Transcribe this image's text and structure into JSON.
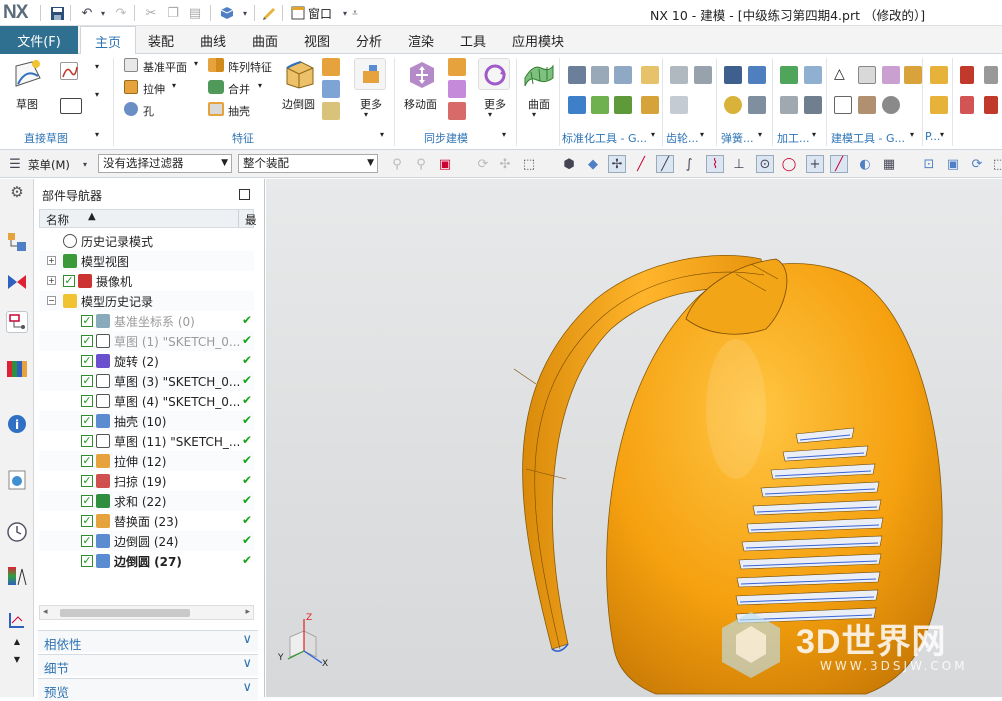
{
  "app": {
    "logo": "NX",
    "window_title": "NX 10 - 建模 - [中级练习第四期4.prt （修改的）]",
    "window_menu": "窗口"
  },
  "menu": {
    "file": "文件(F)",
    "tabs": [
      "主页",
      "装配",
      "曲线",
      "曲面",
      "视图",
      "分析",
      "渲染",
      "工具",
      "应用模块"
    ]
  },
  "ribbon": {
    "sketch": "草图",
    "datum_plane": "基准平面",
    "extrude": "拉伸",
    "hole": "孔",
    "pattern_feature": "阵列特征",
    "unite": "合并",
    "shell": "抽壳",
    "edge_blend": "边倒圆",
    "more": "更多",
    "move_face": "移动面",
    "more2": "更多",
    "surface": "曲面",
    "groups": {
      "direct_sketch": "直接草图",
      "feature": "特征",
      "sync_modeling": "同步建模",
      "standard_tools": "标准化工具 - G...",
      "gear": "齿轮...",
      "spring": "弹簧...",
      "machining": "加工...",
      "modeling_tools": "建模工具 - G...",
      "p": "P..."
    }
  },
  "toolbar2": {
    "menu": "菜单(M)",
    "filter": "没有选择过滤器",
    "scope": "整个装配"
  },
  "navigator": {
    "title": "部件导航器",
    "col_name": "名称",
    "col_latest": "最",
    "rows": [
      {
        "label": "历史记录模式",
        "indent": 0,
        "icon": "clock",
        "check": false,
        "ok": false,
        "style": ""
      },
      {
        "label": "模型视图",
        "indent": 0,
        "icon": "view",
        "check": false,
        "ok": false,
        "style": "",
        "exp": "+"
      },
      {
        "label": "摄像机",
        "indent": 0,
        "icon": "camera",
        "check": true,
        "ok": false,
        "style": "",
        "exp": "+"
      },
      {
        "label": "模型历史记录",
        "indent": 0,
        "icon": "folder",
        "check": false,
        "ok": false,
        "style": "",
        "exp": "-"
      },
      {
        "label": "基准坐标系 (0)",
        "indent": 1,
        "icon": "csys",
        "check": true,
        "ok": true,
        "style": "gray"
      },
      {
        "label": "草图 (1) \"SKETCH_0...",
        "indent": 1,
        "icon": "sketch",
        "check": true,
        "ok": true,
        "style": "gray"
      },
      {
        "label": "旋转 (2)",
        "indent": 1,
        "icon": "revolve",
        "check": true,
        "ok": true,
        "style": ""
      },
      {
        "label": "草图 (3) \"SKETCH_0...",
        "indent": 1,
        "icon": "sketch",
        "check": true,
        "ok": true,
        "style": ""
      },
      {
        "label": "草图 (4) \"SKETCH_0...",
        "indent": 1,
        "icon": "sketch",
        "check": true,
        "ok": true,
        "style": ""
      },
      {
        "label": "抽壳 (10)",
        "indent": 1,
        "icon": "shell",
        "check": true,
        "ok": true,
        "style": ""
      },
      {
        "label": "草图 (11) \"SKETCH_...",
        "indent": 1,
        "icon": "sketch",
        "check": true,
        "ok": true,
        "style": ""
      },
      {
        "label": "拉伸 (12)",
        "indent": 1,
        "icon": "extrude",
        "check": true,
        "ok": true,
        "style": ""
      },
      {
        "label": "扫掠 (19)",
        "indent": 1,
        "icon": "sweep",
        "check": true,
        "ok": true,
        "style": ""
      },
      {
        "label": "求和 (22)",
        "indent": 1,
        "icon": "unite",
        "check": true,
        "ok": true,
        "style": ""
      },
      {
        "label": "替换面 (23)",
        "indent": 1,
        "icon": "replace",
        "check": true,
        "ok": true,
        "style": ""
      },
      {
        "label": "边倒圆 (24)",
        "indent": 1,
        "icon": "blend",
        "check": true,
        "ok": true,
        "style": ""
      },
      {
        "label": "边倒圆 (27)",
        "indent": 1,
        "icon": "blend",
        "check": true,
        "ok": true,
        "style": "bold"
      }
    ],
    "panels": [
      "相依性",
      "细节",
      "预览"
    ]
  },
  "triad": {
    "x": "X",
    "y": "Y",
    "z": "Z"
  },
  "watermark": {
    "brand": "3D世界网",
    "url": "WWW.3DSJW.COM"
  },
  "colors": {
    "accent": "#2e74b5",
    "file_tab": "#2f6f8f",
    "part": "#f5a00f",
    "check": "#1aa31a"
  }
}
